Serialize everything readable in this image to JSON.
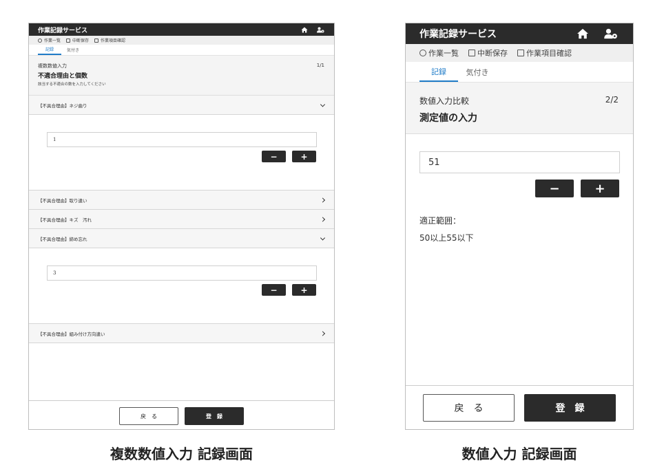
{
  "left": {
    "app_title": "作業記録サービス",
    "toolbar": {
      "list": "作業一覧",
      "pause_save": "中断保存",
      "confirm": "作業項目確認"
    },
    "tabs": [
      "記録",
      "気付き"
    ],
    "input_type": "複数数値入力",
    "title": "不適合理由と個数",
    "description": "該当する不適合の数を入力してください",
    "page": "1/1",
    "reasons": [
      {
        "label": "【不具合理由】ネジ曲り",
        "expanded": true,
        "value": "1"
      },
      {
        "label": "【不具合理由】取り違い",
        "expanded": false
      },
      {
        "label": "【不具合理由】キズ　汚れ",
        "expanded": false
      },
      {
        "label": "【不具合理由】締め忘れ",
        "expanded": true,
        "value": "3"
      },
      {
        "label": "【不具合理由】組み付け方向違い",
        "expanded": false
      }
    ],
    "minus": "−",
    "plus": "+",
    "back": "戻　る",
    "submit": "登　録"
  },
  "right": {
    "app_title": "作業記録サービス",
    "toolbar": {
      "list": "作業一覧",
      "pause_save": "中断保存",
      "confirm": "作業項目確認"
    },
    "tabs": [
      "記録",
      "気付き"
    ],
    "input_type": "数値入力比較",
    "title": "測定値の入力",
    "page": "2/2",
    "value": "51",
    "range_label": "適正範囲：",
    "range_value": "50以上55以下",
    "minus": "−",
    "plus": "+",
    "back": "戻　る",
    "submit": "登　録"
  },
  "captions": {
    "left": "複数数値入力 記録画面",
    "right": "数値入力 記録画面"
  },
  "colors": {
    "header": "#2b2b2b",
    "tab_active": "#1e7bc8",
    "section_bg": "#f4f4f4"
  },
  "icons": [
    "home-icon",
    "user-settings-icon",
    "back-circle-icon",
    "save-icon",
    "list-icon",
    "chevron-down-icon",
    "chevron-right-icon"
  ]
}
